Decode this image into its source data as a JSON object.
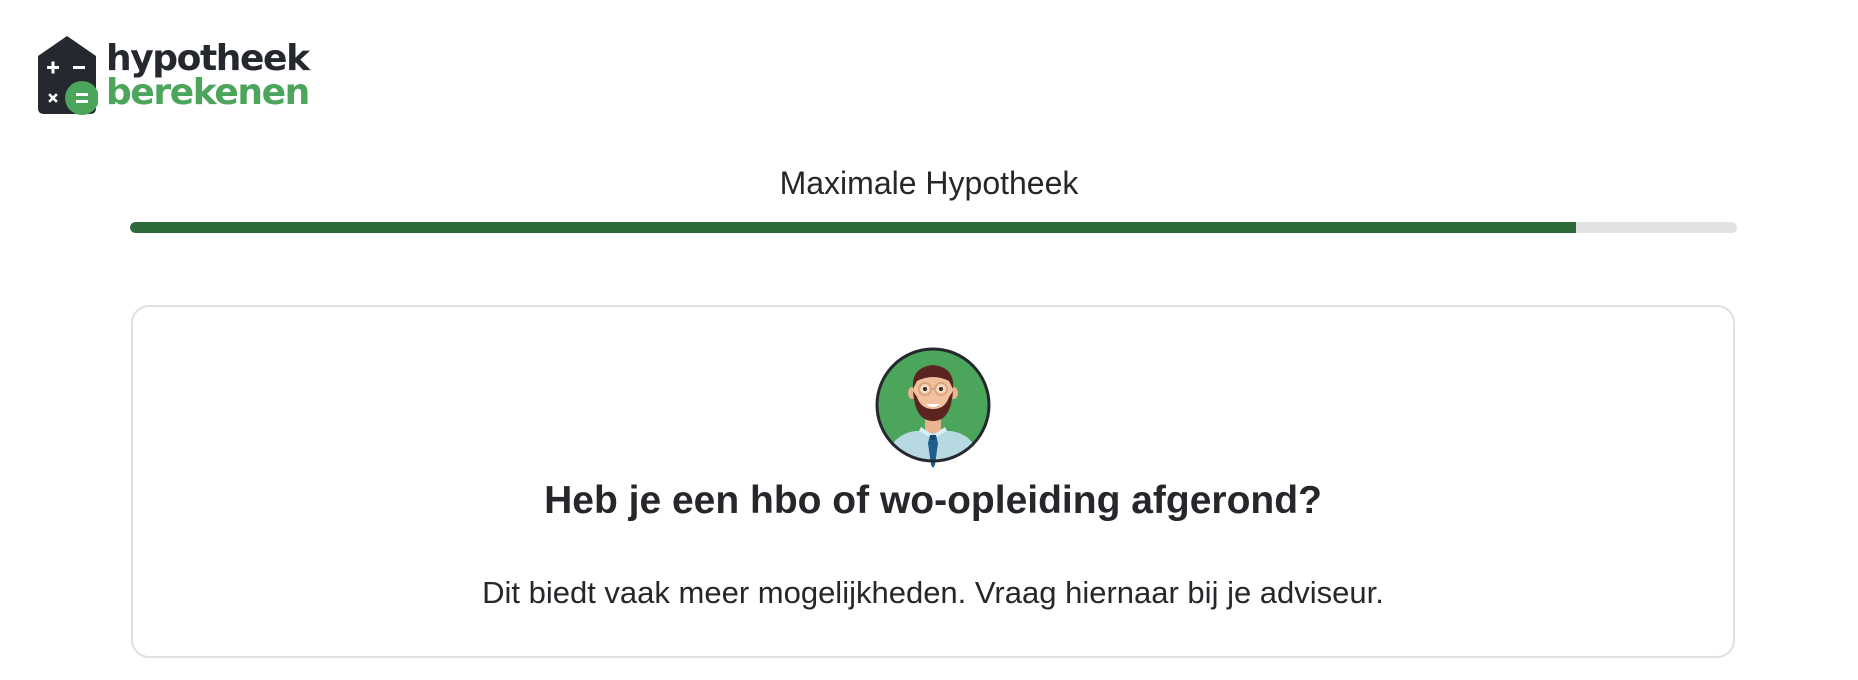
{
  "brand": {
    "line1": "hypotheek",
    "line2": "berekenen",
    "icon": "calculator-house-icon",
    "colors": {
      "dark": "#25292f",
      "green": "#4ba55a"
    }
  },
  "progress": {
    "title": "Maximale Hypotheek",
    "fraction": 0.9,
    "fill_color": "#2c6a3a",
    "track_color": "#e2e2e2"
  },
  "card": {
    "avatar_icon": "advisor-avatar-icon",
    "question": "Heb je een hbo of wo-opleiding afgerond?",
    "hint": "Dit biedt vaak meer mogelijkheden. Vraag hiernaar bij je adviseur."
  }
}
